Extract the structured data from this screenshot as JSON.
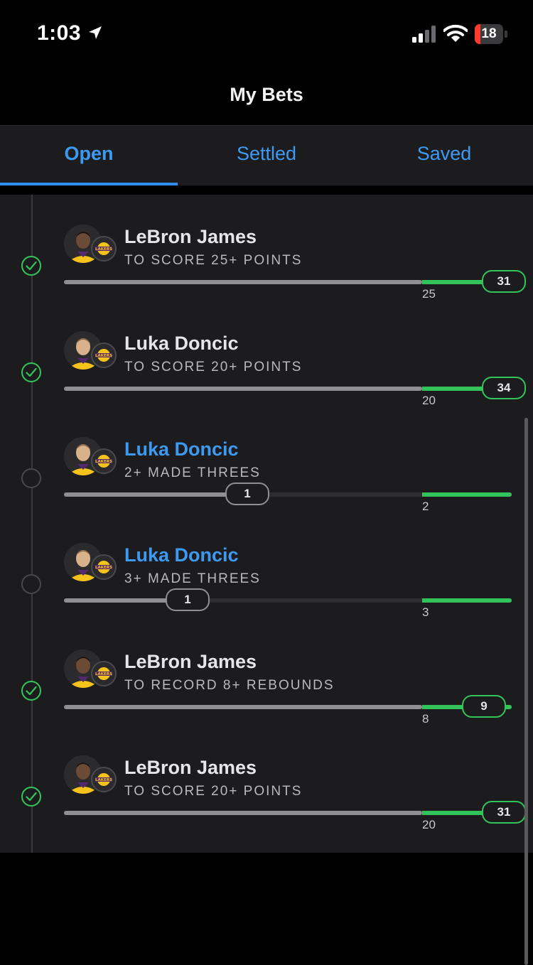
{
  "status_bar": {
    "time": "1:03",
    "battery": "18",
    "location_icon": "location-arrow-icon",
    "signal_icon": "cellular-signal-icon",
    "wifi_icon": "wifi-icon"
  },
  "header": {
    "title": "My Bets"
  },
  "tabs": [
    {
      "label": "Open",
      "active": true
    },
    {
      "label": "Settled",
      "active": false
    },
    {
      "label": "Saved",
      "active": false
    }
  ],
  "colors": {
    "accent_blue": "#3d9af2",
    "win_green": "#32c45b",
    "background": "#1c1c1e"
  },
  "bets": [
    {
      "player": "LeBron James",
      "prop": "TO SCORE 25+ POINTS",
      "current": "31",
      "target": "25",
      "status": "won",
      "progress": 1.0,
      "highlight": false
    },
    {
      "player": "Luka Doncic",
      "prop": "TO SCORE 20+ POINTS",
      "current": "34",
      "target": "20",
      "status": "won",
      "progress": 1.0,
      "highlight": false
    },
    {
      "player": "Luka Doncic",
      "prop": "2+ MADE THREES",
      "current": "1",
      "target": "2",
      "status": "open",
      "progress": 0.5,
      "highlight": true
    },
    {
      "player": "Luka Doncic",
      "prop": "3+ MADE THREES",
      "current": "1",
      "target": "3",
      "status": "open",
      "progress": 0.333,
      "highlight": true
    },
    {
      "player": "LeBron James",
      "prop": "TO RECORD 8+ REBOUNDS",
      "current": "9",
      "target": "8",
      "status": "won",
      "progress": 1.0,
      "highlight": false
    },
    {
      "player": "LeBron James",
      "prop": "TO SCORE 20+ POINTS",
      "current": "31",
      "target": "20",
      "status": "won",
      "progress": 1.0,
      "highlight": false
    }
  ]
}
